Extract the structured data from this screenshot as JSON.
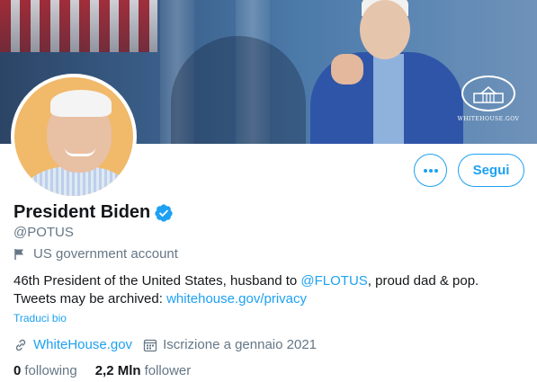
{
  "banner": {
    "logo_text": "WHITEHOUSE.GOV"
  },
  "profile": {
    "name": "President Biden",
    "handle": "@POTUS",
    "account_label": "US government account",
    "bio_line1_prefix": "46th President of the United States, husband to ",
    "bio_mention": "@FLOTUS",
    "bio_line1_suffix": ", proud dad & pop.",
    "bio_line2_prefix": "Tweets may be archived: ",
    "bio_link": "whitehouse.gov/privacy",
    "translate_label": "Traduci bio",
    "website": "WhiteHouse.gov",
    "joined": "Iscrizione a gennaio 2021",
    "following_count": "0",
    "following_label": "following",
    "followers_count": "2,2 Mln",
    "followers_label": "follower"
  },
  "actions": {
    "follow_label": "Segui",
    "more_icon": "more-icon"
  },
  "colors": {
    "accent": "#1da1f2",
    "text_primary": "#14171a",
    "text_secondary": "#657786"
  }
}
